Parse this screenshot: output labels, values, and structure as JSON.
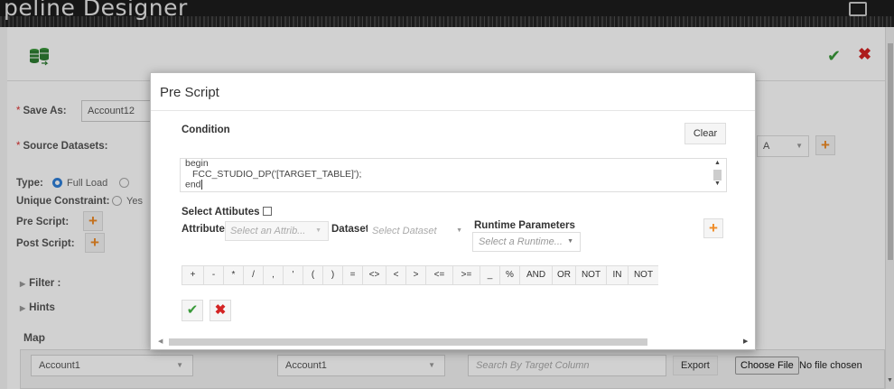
{
  "window": {
    "title": "peline Designer"
  },
  "toolbar": {
    "icon": "database-transfer-icon",
    "ok_icon": "check-icon",
    "cancel_icon": "close-icon"
  },
  "form": {
    "save_as_label": "Save As:",
    "save_as_value": "Account12",
    "source_datasets_label": "Source Datasets:",
    "source_datasets_value_fragment": "A",
    "type_label": "Type:",
    "type_option_full_load": "Full Load",
    "unique_constraint_label": "Unique Constraint:",
    "unique_constraint_option": "Yes",
    "pre_script_label": "Pre Script:",
    "post_script_label": "Post Script:",
    "filter_label": "Filter :",
    "hints_label": "Hints"
  },
  "map": {
    "title": "Map",
    "source_select": "Account1",
    "target_select": "Account1",
    "search_placeholder": "Search By Target Column",
    "export_label": "Export",
    "choose_file_label": "Choose File",
    "no_file_text": "No file chosen"
  },
  "modal": {
    "title": "Pre Script",
    "condition_label": "Condition",
    "clear_label": "Clear",
    "script_lines": [
      "begin",
      "FCC_STUDIO_DP('[TARGET_TABLE]');",
      "end"
    ],
    "select_attributes_label": "Select Attibutes",
    "attribute_label": "Attribute",
    "attribute_placeholder": "Select an Attrib...",
    "dataset_label": "Dataset",
    "dataset_placeholder": "Select Dataset",
    "runtime_params_label": "Runtime Parameters",
    "runtime_placeholder": "Select a Runtime...",
    "operators": [
      "+",
      "-",
      "*",
      "/",
      ",",
      "'",
      "(",
      ")",
      "=",
      "<>",
      "<",
      ">",
      "<=",
      ">=",
      "_",
      "%",
      "AND",
      "OR",
      "NOT",
      "IN",
      "NOT"
    ]
  },
  "colors": {
    "accent_orange": "#f08a24",
    "ok_green": "#3a9a3a",
    "cancel_red": "#d32323",
    "radio_blue": "#2f7fd8"
  }
}
